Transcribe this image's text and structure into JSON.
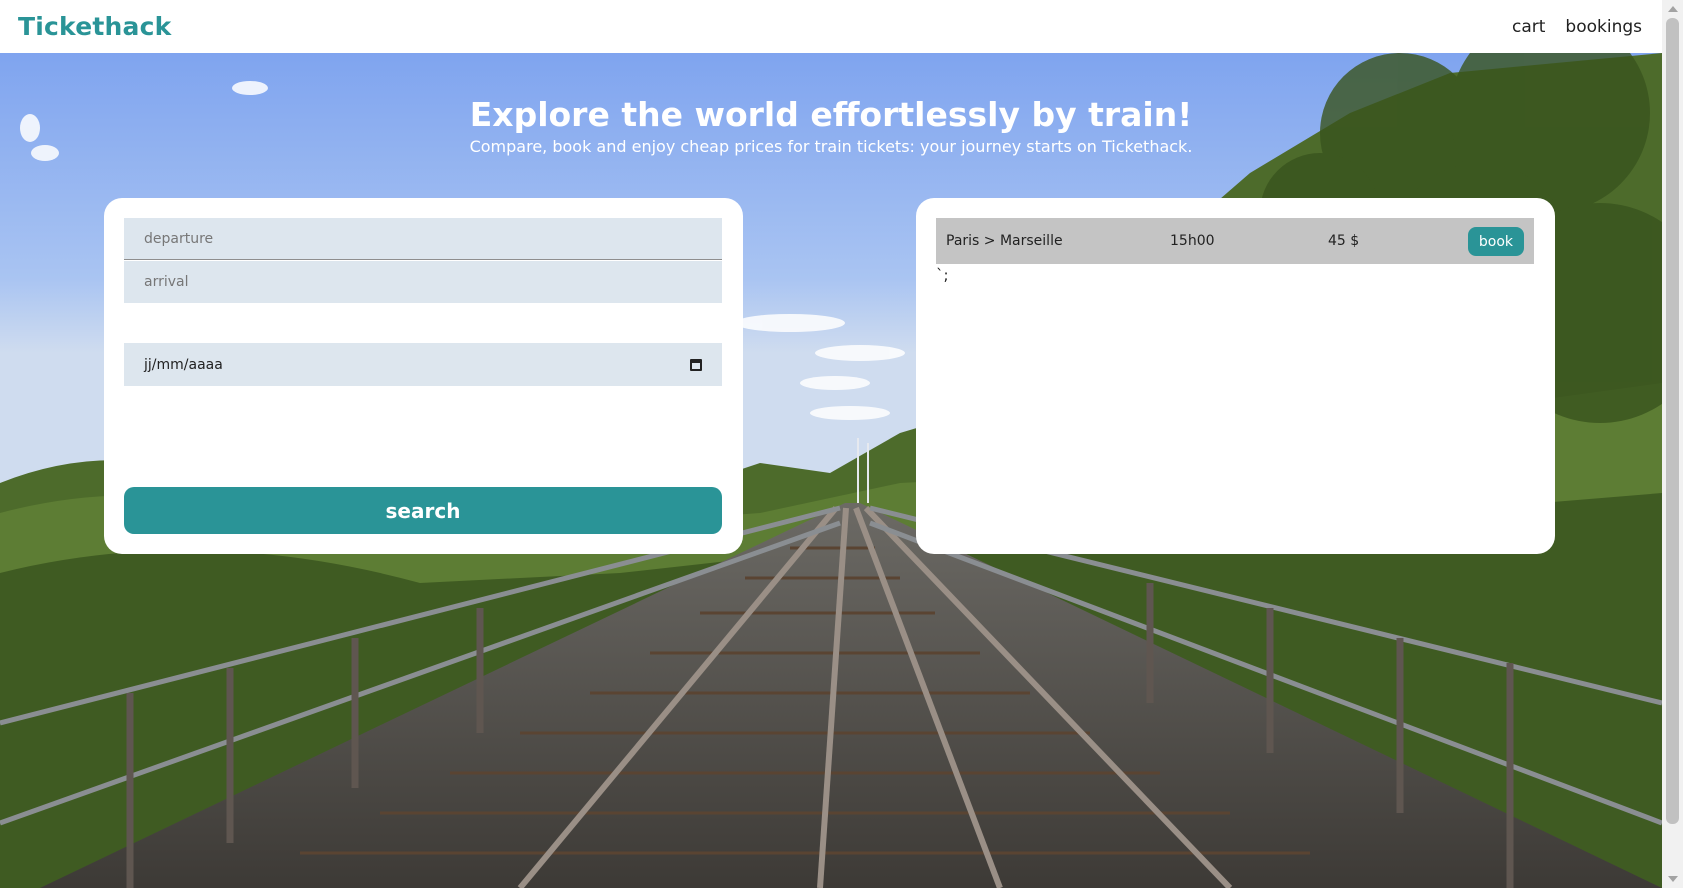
{
  "header": {
    "brand": "Tickethack",
    "nav": {
      "cart": "cart",
      "bookings": "bookings"
    }
  },
  "hero": {
    "headline": "Explore the world effortlessly by train!",
    "subline": "Compare, book and enjoy cheap prices for train tickets: your journey starts on Tickethack."
  },
  "search": {
    "departure_placeholder": "departure",
    "arrival_placeholder": "arrival",
    "date_placeholder": "jj/mm/aaaa",
    "search_label": "search"
  },
  "results": {
    "rows": [
      {
        "route": "Paris > Marseille",
        "time": "15h00",
        "price": "45 $",
        "book_label": "book"
      }
    ],
    "stray_text": "`;"
  },
  "colors": {
    "brand": "#2a9497",
    "field_bg": "#dde6ee",
    "row_bg": "#c4c4c4"
  },
  "icons": [
    "calendar-icon"
  ]
}
